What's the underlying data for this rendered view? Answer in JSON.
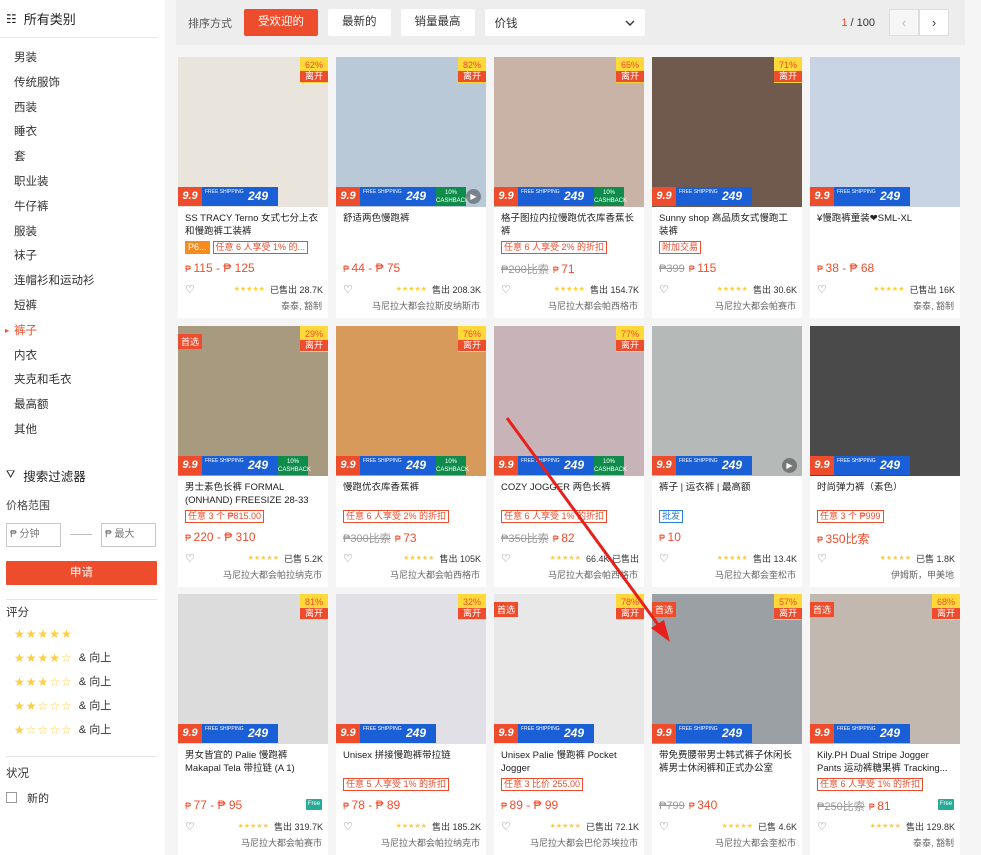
{
  "sidebar": {
    "categories_title": "所有类别",
    "categories": [
      "男装",
      "传统服饰",
      "西装",
      "睡衣",
      "套",
      "职业装",
      "牛仔裤",
      "服装",
      "袜子",
      "连帽衫和运动衫",
      "短裤",
      "裤子",
      "内衣",
      "夹克和毛衣",
      "最高额",
      "其他"
    ],
    "active_category": "裤子",
    "filter_title": "搜索过滤器",
    "price_label": "价格范围",
    "price_min_placeholder": "₱ 分钟",
    "price_max_placeholder": "₱ 最大",
    "apply_label": "申请",
    "rating_title": "评分",
    "ratings": [
      {
        "filled": 5,
        "suffix": ""
      },
      {
        "filled": 4,
        "suffix": "& 向上"
      },
      {
        "filled": 3,
        "suffix": "& 向上"
      },
      {
        "filled": 2,
        "suffix": "& 向上"
      },
      {
        "filled": 1,
        "suffix": "& 向上"
      }
    ],
    "status_title": "状况",
    "status_option": "新的"
  },
  "sortbar": {
    "label": "排序方式",
    "popular": "受欢迎的",
    "latest": "最新的",
    "top_sales": "销量最高",
    "price": "价钱",
    "page_current": "1",
    "page_total": "/ 100"
  },
  "promo": {
    "p99": "9.9",
    "ship": "FREE SHIPPING",
    "p249": "249",
    "cash_pct": "10%",
    "cash": "CASHBACK"
  },
  "colors": {
    "accent": "#ee4d2d",
    "star": "#ffce3d",
    "ship_blue": "#1a5fd6"
  },
  "products": [
    {
      "title": "SS TRACY Terno 女式七分上衣和慢跑裤工装裤",
      "disc": "62%",
      "off": "离开",
      "pref": false,
      "cash": false,
      "play": false,
      "tags": [
        {
          "t": "P6...",
          "c": "fill"
        },
        {
          "t": "任意 6 人享受 1% 的...",
          "c": ""
        }
      ],
      "old": "",
      "price": "115 - ₱ 125",
      "freeship": false,
      "sold": "已售出 28.7K",
      "loc": "泰泰, 豁制",
      "bg": "#e9e4dc"
    },
    {
      "title": "舒适两色慢跑裤",
      "disc": "82%",
      "off": "离开",
      "pref": false,
      "cash": true,
      "play": true,
      "tags": [],
      "old": "",
      "price": "44 - ₱ 75",
      "freeship": false,
      "sold": "售出 208.3K",
      "loc": "马尼拉大都会拉斯皮纳斯市",
      "bg": "#b9c9d8"
    },
    {
      "title": "格子图拉内拉慢跑优衣库香蕉长裤",
      "disc": "65%",
      "off": "离开",
      "pref": false,
      "cash": true,
      "play": false,
      "tags": [
        {
          "t": "任意 6 人享受 2% 的折扣",
          "c": ""
        }
      ],
      "old": "₱200比索",
      "price": "71",
      "freeship": false,
      "sold": "售出 154.7K",
      "loc": "马尼拉大都会帕西格市",
      "bg": "#c9b3a6"
    },
    {
      "title": "Sunny shop 高品质女式慢跑工装裤",
      "disc": "71%",
      "off": "离开",
      "pref": false,
      "cash": false,
      "play": false,
      "tags": [
        {
          "t": "附加交易",
          "c": ""
        }
      ],
      "old": "₱399",
      "price": "115",
      "freeship": false,
      "sold": "售出 30.6K",
      "loc": "马尼拉大都会帕赛市",
      "bg": "#6f5a4d"
    },
    {
      "title": "¥慢跑裤童装❤SML-XL",
      "disc": "",
      "off": "",
      "pref": false,
      "cash": false,
      "play": false,
      "tags": [],
      "old": "",
      "price": "38 - ₱ 68",
      "freeship": false,
      "sold": "已售出 16K",
      "loc": "泰泰, 豁制",
      "bg": "#c8d3e4"
    },
    {
      "title": "男士素色长裤 FORMAL (ONHAND) FREESIZE 28-33",
      "disc": "29%",
      "off": "离开",
      "pref": true,
      "cash": true,
      "play": false,
      "tags": [
        {
          "t": "任意 3 个 ₱815.00",
          "c": ""
        }
      ],
      "old": "",
      "price": "220 - ₱ 310",
      "freeship": false,
      "sold": "已售 5.2K",
      "loc": "马尼拉大都会帕拉纳克市",
      "bg": "#a89a7e"
    },
    {
      "title": "慢跑优衣库香蕉裤",
      "disc": "76%",
      "off": "离开",
      "pref": false,
      "cash": true,
      "play": false,
      "tags": [
        {
          "t": "任意 6 人享受 2% 的折扣",
          "c": ""
        }
      ],
      "old": "₱300比索",
      "price": "73",
      "freeship": false,
      "sold": "售出 105K",
      "loc": "马尼拉大都会帕西格市",
      "bg": "#d79a5a"
    },
    {
      "title": "COZY JOGGER 两色长裤",
      "disc": "77%",
      "off": "离开",
      "pref": false,
      "cash": true,
      "play": false,
      "tags": [
        {
          "t": "任意 6 人享受 1% 的折扣",
          "c": ""
        }
      ],
      "old": "₱350比索",
      "price": "82",
      "freeship": false,
      "sold": "66.4K 已售出",
      "loc": "马尼拉大都会帕西格市",
      "bg": "#c8b4b8"
    },
    {
      "title": "裤子 | 运衣裤 | 最高额",
      "disc": "",
      "off": "",
      "pref": false,
      "cash": false,
      "play": true,
      "tags": [
        {
          "t": "批发",
          "c": "blue"
        }
      ],
      "old": "",
      "price": "10",
      "freeship": false,
      "sold": "售出 13.4K",
      "loc": "马尼拉大都会奎松市",
      "bg": "#b5b9b8"
    },
    {
      "title": "时尚弹力裤（素色）",
      "disc": "",
      "off": "",
      "pref": false,
      "cash": false,
      "play": false,
      "tags": [
        {
          "t": "任意 3 个 ₱999",
          "c": ""
        }
      ],
      "old": "",
      "price": "350比索",
      "freeship": false,
      "sold": "已售 1.8K",
      "loc": "伊姆斯，甲美地",
      "bg": "#4a4a4a"
    },
    {
      "title": "男女皆宜的 Palie 慢跑裤 Makapal Tela 带拉链 (A 1)",
      "disc": "81%",
      "off": "离开",
      "pref": false,
      "cash": false,
      "play": false,
      "tags": [],
      "old": "",
      "price": "77 - ₱ 95",
      "freeship": true,
      "sold": "售出 319.7K",
      "loc": "马尼拉大都会帕赛市",
      "bg": "#dcdcdc"
    },
    {
      "title": "Unisex 拼接慢跑裤带拉链",
      "disc": "32%",
      "off": "离开",
      "pref": false,
      "cash": false,
      "play": false,
      "tags": [
        {
          "t": "任意 5 人享受 1% 的折扣",
          "c": ""
        }
      ],
      "old": "",
      "price": "78 - ₱ 89",
      "freeship": false,
      "sold": "售出 185.2K",
      "loc": "马尼拉大都会帕拉纳克市",
      "bg": "#e0e0e6"
    },
    {
      "title": "Unisex Palie 慢跑裤 Pocket Jogger",
      "disc": "78%",
      "off": "离开",
      "pref": true,
      "cash": false,
      "play": false,
      "tags": [
        {
          "t": "任意 3 比价 255.00",
          "c": ""
        }
      ],
      "old": "",
      "price": "89 - ₱ 99",
      "freeship": false,
      "sold": "已售出 72.1K",
      "loc": "马尼拉大都会巴伦苏埃拉市",
      "bg": "#e8e8e8"
    },
    {
      "title": "带免费腰带男士韩式裤子休闲长裤男士休闲裤和正式办公室",
      "disc": "57%",
      "off": "离开",
      "pref": true,
      "cash": false,
      "play": false,
      "tags": [],
      "old": "₱799",
      "price": "340",
      "freeship": false,
      "sold": "已售 4.6K",
      "loc": "马尼拉大都会奎松市",
      "bg": "#9aa0a4"
    },
    {
      "title": "Kily.PH Dual Stripe Jogger Pants 运动裤糖果裤 Tracking...",
      "disc": "68%",
      "off": "离开",
      "pref": true,
      "cash": false,
      "play": false,
      "tags": [
        {
          "t": "任意 6 人享受 1% 的折扣",
          "c": ""
        }
      ],
      "old": "₱250比索",
      "price": "81",
      "freeship": true,
      "sold": "售出 129.8K",
      "loc": "泰泰, 豁制",
      "bg": "#c2b8b0"
    }
  ]
}
